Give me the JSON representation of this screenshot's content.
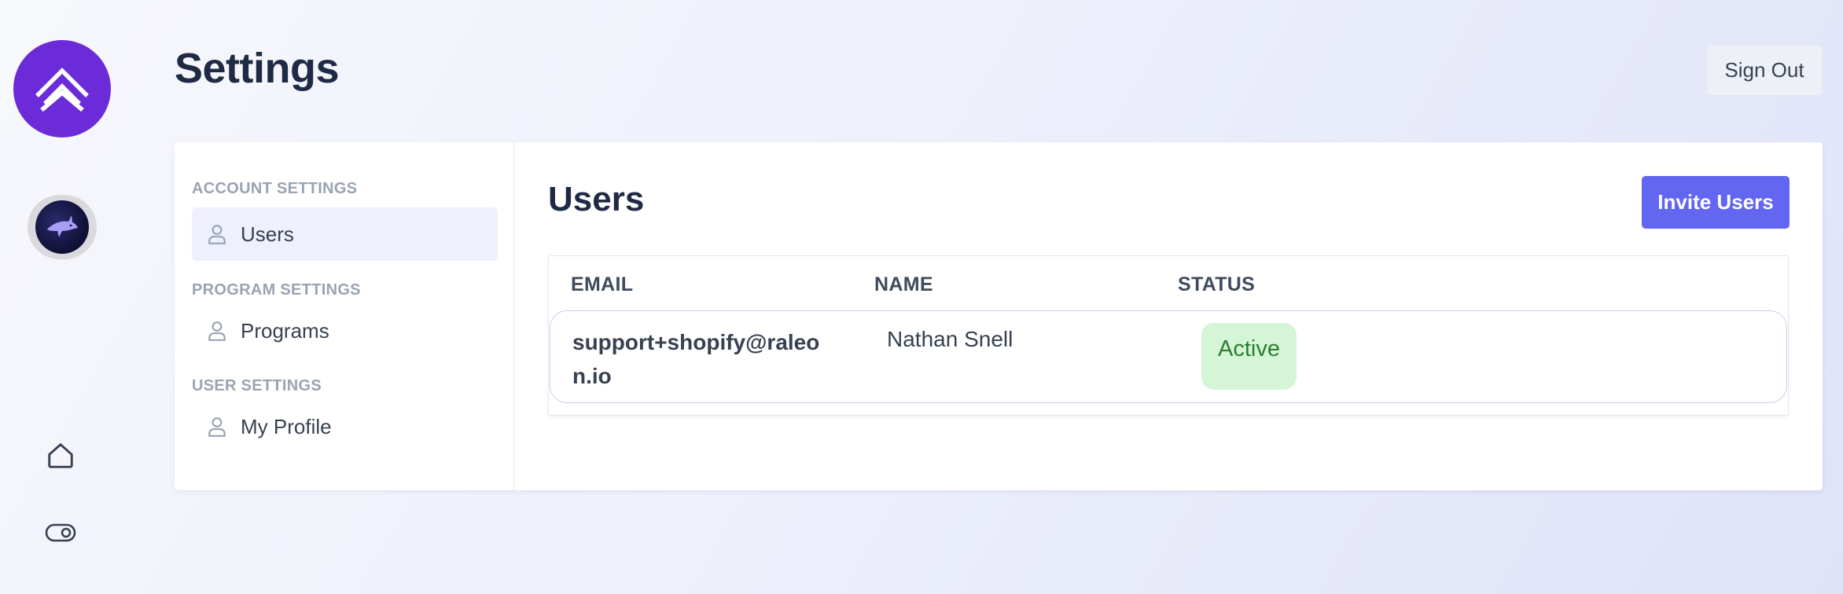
{
  "header": {
    "title": "Settings",
    "sign_out_label": "Sign Out"
  },
  "rail": {
    "logo_icon": "brand-chevrons-icon",
    "program_avatar_icon": "shark-icon",
    "items": [
      {
        "icon": "home-icon"
      },
      {
        "icon": "toggle-icon"
      }
    ]
  },
  "sidebar": {
    "sections": [
      {
        "label": "ACCOUNT SETTINGS",
        "items": [
          {
            "label": "Users",
            "icon": "user-icon",
            "active": true
          }
        ]
      },
      {
        "label": "PROGRAM SETTINGS",
        "items": [
          {
            "label": "Programs",
            "icon": "user-icon",
            "active": false
          }
        ]
      },
      {
        "label": "USER SETTINGS",
        "items": [
          {
            "label": "My Profile",
            "icon": "user-icon",
            "active": false
          }
        ]
      }
    ]
  },
  "main": {
    "title": "Users",
    "invite_label": "Invite Users",
    "table": {
      "columns": [
        "EMAIL",
        "NAME",
        "STATUS"
      ],
      "rows": [
        {
          "email": "support+shopify@raleon.io",
          "name": "Nathan Snell",
          "status": "Active"
        }
      ]
    }
  },
  "colors": {
    "brand": "#6c2bd9",
    "accent": "#6366f1",
    "status_active_bg": "#d4f5d6",
    "status_active_text": "#2e7d32"
  }
}
